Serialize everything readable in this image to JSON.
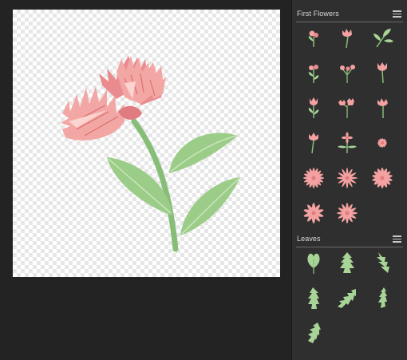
{
  "sections": {
    "first_flowers": {
      "title": "First Flowers",
      "items": [
        "flower-bud-pair",
        "flower-tulip-single",
        "leaf-sprig",
        "flower-bud-cluster",
        "flower-stem-trio",
        "flower-tulip-tall",
        "flower-tulip-leaves",
        "flower-bud-double",
        "flower-tulip-bloom",
        "flower-tulip-stem",
        "flower-daisy-stem",
        "flower-daisy-small",
        "flower-daisy-large",
        "flower-daisy-star",
        "flower-daisy-wide",
        "flower-daisy-round",
        "flower-daisy-pointed"
      ]
    },
    "leaves": {
      "title": "Leaves",
      "items": [
        "leaf-heart",
        "leaf-fern-upright",
        "leaf-fern-tall",
        "leaf-fern-broad",
        "leaf-fern-curved",
        "leaf-fern-slim",
        "leaf-fern-small"
      ]
    }
  },
  "colors": {
    "petal_pink": "#f3a1a1",
    "petal_dark": "#e07c80",
    "stem_green": "#86be78",
    "leaf_green": "#a8d597",
    "panel_bg": "#2f2f2f",
    "canvas_bg": "#232323"
  }
}
